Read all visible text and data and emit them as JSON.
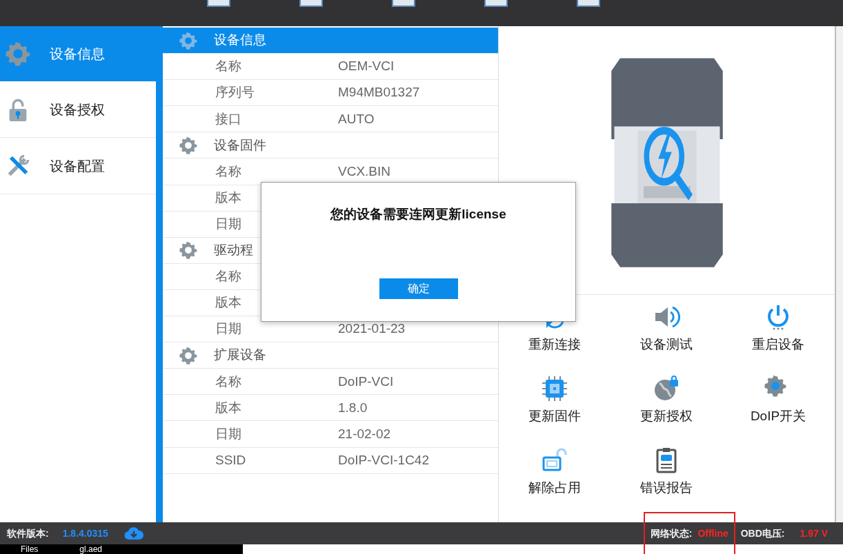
{
  "sidebar": {
    "items": [
      {
        "label": "设备信息",
        "selected": true
      },
      {
        "label": "设备授权",
        "selected": false
      },
      {
        "label": "设备配置",
        "selected": false
      }
    ]
  },
  "info_table": {
    "sections": [
      {
        "title": "设备信息",
        "selected": true,
        "rows": [
          {
            "label": "名称",
            "value": "OEM-VCI"
          },
          {
            "label": "序列号",
            "value": "M94MB01327"
          },
          {
            "label": "接口",
            "value": "AUTO"
          }
        ]
      },
      {
        "title": "设备固件",
        "selected": false,
        "rows": [
          {
            "label": "名称",
            "value": "VCX.BIN"
          },
          {
            "label": "版本"
          },
          {
            "label": "日期"
          }
        ]
      },
      {
        "title": "驱动程",
        "selected": false,
        "rows": [
          {
            "label": "名称"
          },
          {
            "label": "版本"
          },
          {
            "label": "日期",
            "value": "2021-01-23"
          }
        ]
      },
      {
        "title": "扩展设备",
        "selected": false,
        "rows": [
          {
            "label": "名称",
            "value": "DoIP-VCI"
          },
          {
            "label": "版本",
            "value": "1.8.0"
          },
          {
            "label": "日期",
            "value": "21-02-02"
          },
          {
            "label": "SSID",
            "value": "DoIP-VCI-1C42"
          }
        ]
      }
    ]
  },
  "dialog": {
    "message": "您的设备需要连网更新license",
    "button": "确定"
  },
  "actions": [
    {
      "label": "重新连接"
    },
    {
      "label": "设备测试"
    },
    {
      "label": "重启设备"
    },
    {
      "label": "更新固件"
    },
    {
      "label": "更新授权"
    },
    {
      "label": "DoIP开关"
    },
    {
      "label": "解除占用"
    },
    {
      "label": "错误报告"
    }
  ],
  "status_bar": {
    "software_version_label": "软件版本:",
    "software_version": "1.8.4.0315",
    "network_label": "网络状态:",
    "network_status": "Offline",
    "obd_label": "OBD电压:",
    "obd_voltage": "1.97 V"
  },
  "taskbar": {
    "items": [
      "Files",
      "gl.aed"
    ]
  }
}
